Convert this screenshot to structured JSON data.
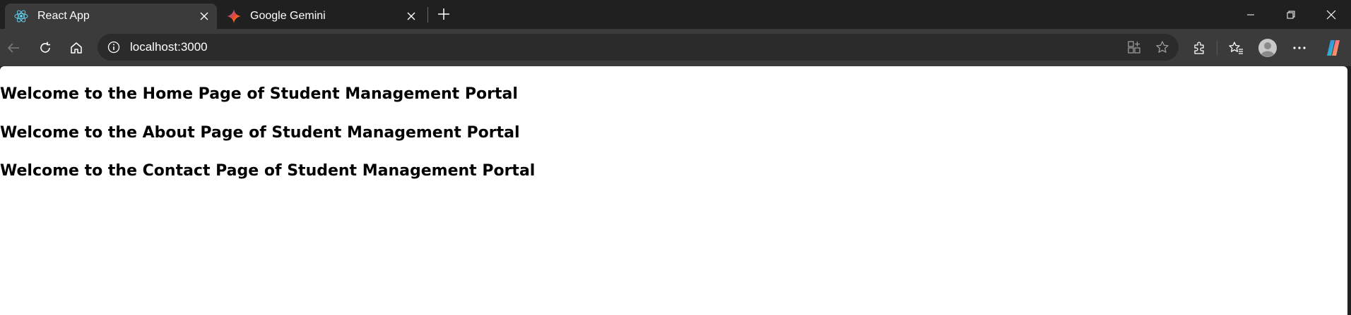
{
  "browser": {
    "tabs": [
      {
        "title": "React App",
        "active": true,
        "favicon": "react-icon"
      },
      {
        "title": "Google Gemini",
        "active": false,
        "favicon": "gemini-icon"
      }
    ],
    "address_bar": {
      "url": "localhost:3000"
    },
    "colors": {
      "chrome_dark": "#202020",
      "toolbar": "#3b3b3b",
      "address_bg": "#2b2b2b",
      "react_blue": "#61dafb"
    }
  },
  "page": {
    "headings": [
      "Welcome to the Home Page of Student Management Portal",
      "Welcome to the About Page of Student Management Portal",
      "Welcome to the Contact Page of Student Management Portal"
    ]
  }
}
